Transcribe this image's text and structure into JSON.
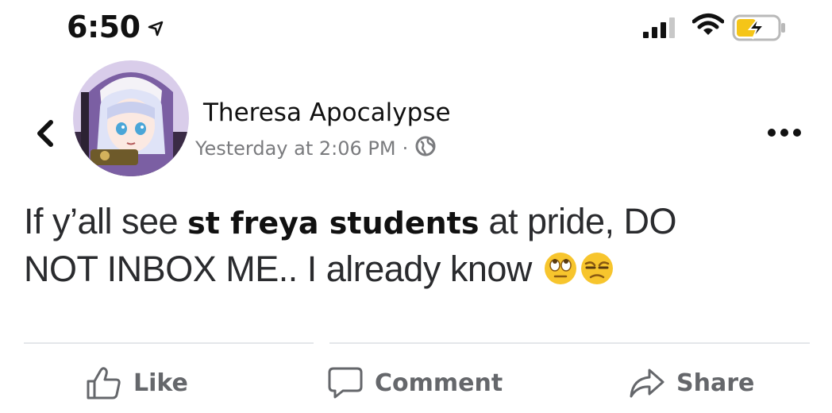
{
  "status_bar": {
    "time": "6:50"
  },
  "post": {
    "author": "Theresa Apocalypse",
    "timestamp": "Yesterday at 2:06 PM",
    "separator": "·",
    "text_line1_start": "If y’all see ",
    "text_line1_bold": "st freya students",
    "text_line1_end": " at pride, DO",
    "text_line2": "NOT INBOX ME.. I already know"
  },
  "actions": {
    "like": "Like",
    "comment": "Comment",
    "share": "Share"
  },
  "icons": {
    "location": "location-arrow-icon",
    "signal": "cellular-signal-icon",
    "wifi": "wifi-icon",
    "battery": "battery-charging-icon",
    "back": "chevron-left-icon",
    "privacy": "globe-icon",
    "more": "more-options-icon",
    "like": "thumbs-up-icon",
    "comment": "comment-bubble-icon",
    "share": "share-arrow-icon",
    "emoji1": "eye-roll-emoji",
    "emoji2": "unamused-emoji"
  },
  "colors": {
    "battery_charge": "#f5c518",
    "muted": "#65676b",
    "avatar_bg": "#cdb8e6"
  }
}
